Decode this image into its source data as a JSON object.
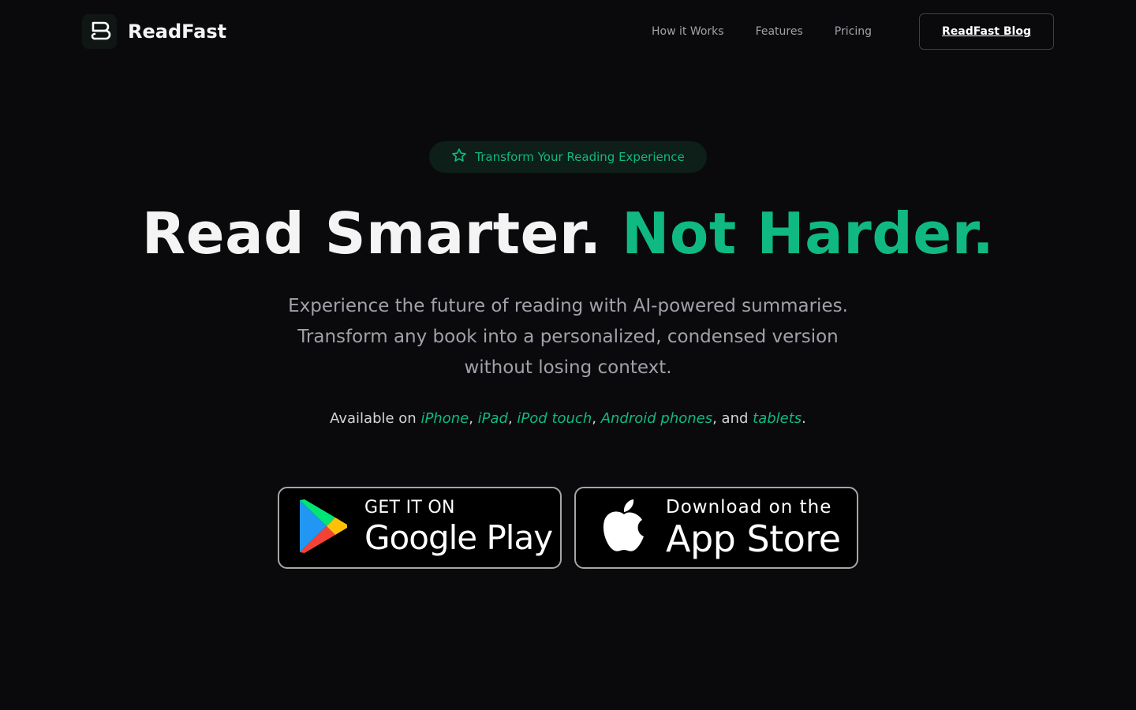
{
  "brand": {
    "name": "ReadFast",
    "logo_icon": "book-icon"
  },
  "nav": {
    "items": [
      "How it Works",
      "Features",
      "Pricing"
    ],
    "blog_button": "ReadFast Blog"
  },
  "hero": {
    "badge": {
      "icon": "star-icon",
      "text": "Transform Your Reading Experience"
    },
    "headline_white": "Read Smarter.",
    "headline_green": "Not Harder.",
    "subtitle_lines": [
      "Experience the future of reading with AI-powered summaries.",
      "Transform any book into a personalized, condensed version",
      "without losing context."
    ],
    "availability": {
      "prefix": "Available on ",
      "devices": [
        "iPhone",
        "iPad",
        "iPod touch",
        "Android phones"
      ],
      "and": ", and ",
      "last_device": "tablets",
      "suffix": "."
    }
  },
  "stores": {
    "google": {
      "small": "GET IT ON",
      "big": "Google Play",
      "icon": "google-play-icon"
    },
    "apple": {
      "small": "Download on the",
      "big": "App Store",
      "icon": "apple-icon"
    }
  },
  "colors": {
    "background": "#0a0a0c",
    "accent": "#10b981",
    "text": "#f4f4f5",
    "muted": "#a1a1aa"
  }
}
